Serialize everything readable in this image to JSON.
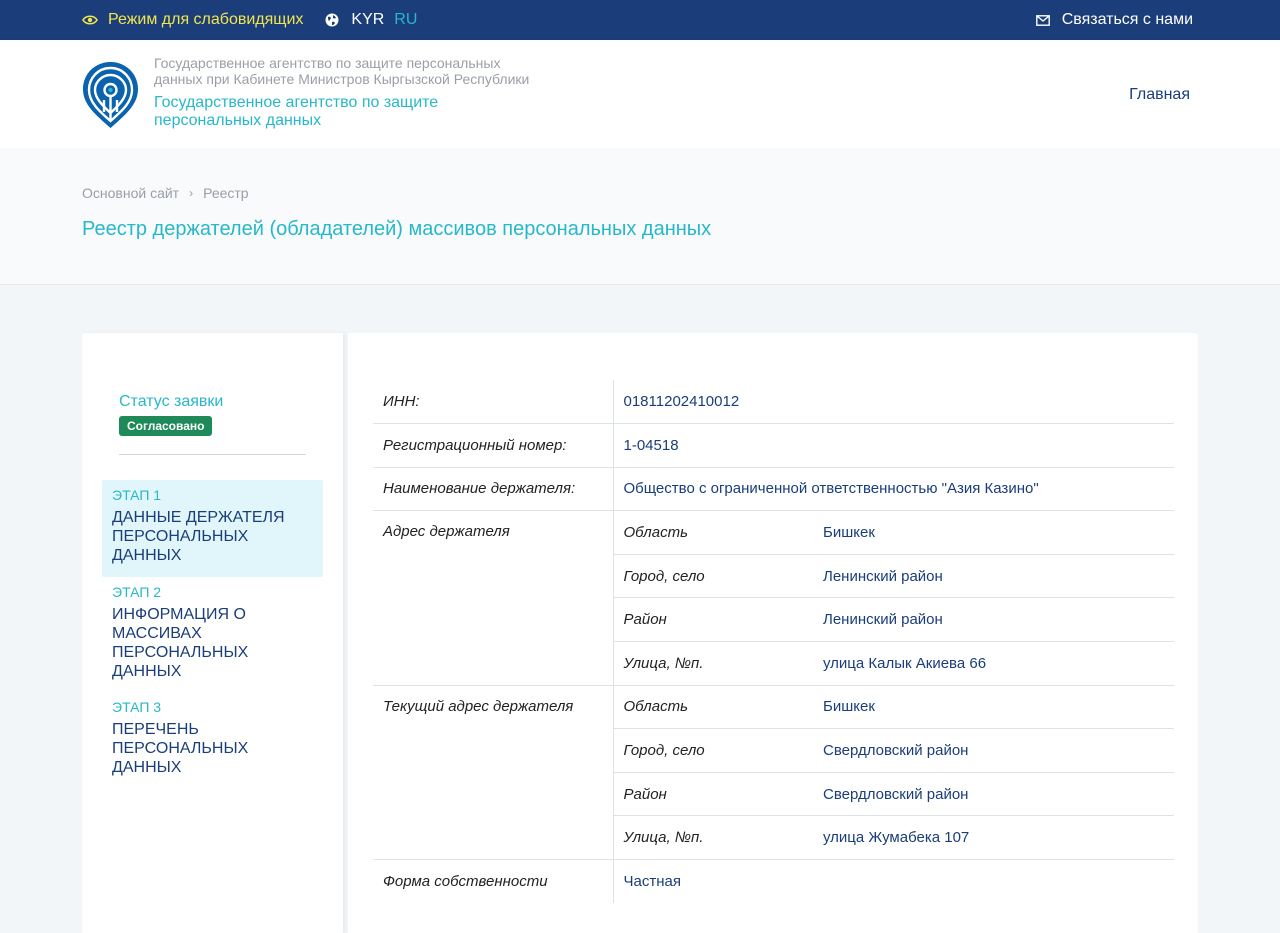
{
  "topbar": {
    "vision_label": "Режим для слабовидящих",
    "lang_kyr": "KYR",
    "lang_ru": "RU",
    "contact_label": "Связаться с нами"
  },
  "header": {
    "org_sub": "Государственное агентство по защите персональных данных при Кабинете Министров Кыргызской Республики",
    "org_main": "Государственное агентство по защите персональных данных",
    "nav_home": "Главная"
  },
  "breadcrumb": {
    "items": [
      "Основной сайт",
      "Реестр"
    ],
    "separator": "›"
  },
  "page_title": "Реестр держателей (обладателей) массивов персональных данных",
  "sidebar": {
    "status_label": "Статус заявки",
    "status_badge": "Согласовано",
    "steps": [
      {
        "num": "ЭТАП 1",
        "title": "Данные держателя персональных данных",
        "active": true
      },
      {
        "num": "ЭТАП 2",
        "title": "Информация о массивах персональных данных",
        "active": false
      },
      {
        "num": "ЭТАП 3",
        "title": "Перечень персональных данных",
        "active": false
      }
    ]
  },
  "details": {
    "inn_label": "ИНН:",
    "inn_value": "01811202410012",
    "reg_label": "Регистрационный номер:",
    "reg_value": "1-04518",
    "name_label": "Наименование держателя:",
    "name_value": "Общество с ограниченной ответственностью \"Азия Казино\"",
    "address_label": "Адрес держателя",
    "address": [
      {
        "k": "Область",
        "v": "Бишкек"
      },
      {
        "k": "Город, село",
        "v": "Ленинский район"
      },
      {
        "k": "Район",
        "v": "Ленинский район"
      },
      {
        "k": "Улица, №п.",
        "v": "улица Калык Акиева 66"
      }
    ],
    "current_address_label": "Текущий адрес держателя",
    "current_address": [
      {
        "k": "Область",
        "v": "Бишкек"
      },
      {
        "k": "Город, село",
        "v": "Свердловский район"
      },
      {
        "k": "Район",
        "v": "Свердловский район"
      },
      {
        "k": "Улица, №п.",
        "v": "улица Жумабека 107"
      }
    ],
    "ownership_label": "Форма собственности",
    "ownership_value": "Частная"
  },
  "colors": {
    "topbar": "#1b3d7a",
    "accent": "#27b8c9",
    "badge": "#1e8a5a",
    "vision": "#f2e64f"
  }
}
